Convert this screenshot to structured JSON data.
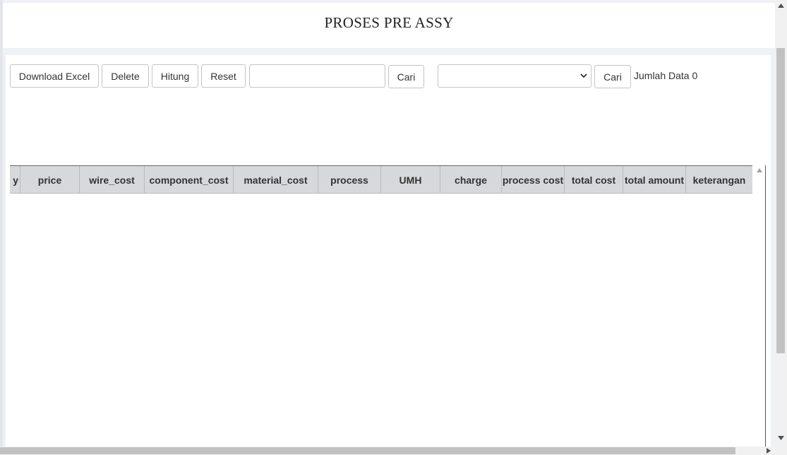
{
  "header": {
    "title": "PROSES PRE ASSY"
  },
  "toolbar": {
    "download_excel": "Download Excel",
    "delete": "Delete",
    "hitung": "Hitung",
    "reset": "Reset",
    "search_value": "",
    "search_button": "Cari",
    "select_value": "",
    "select_search_button": "Cari",
    "count_label": "Jumlah Data 0"
  },
  "table": {
    "columns": [
      "y",
      "price",
      "wire_cost",
      "component_cost",
      "material_cost",
      "process",
      "UMH",
      "charge",
      "process cost",
      "total cost",
      "total amount",
      "keterangan"
    ],
    "rows": []
  },
  "icons": {
    "select_caret": "chevron-down-icon",
    "scroll_up": "triangle-up-icon",
    "scroll_down": "triangle-down-icon",
    "scroll_right": "triangle-right-icon"
  }
}
